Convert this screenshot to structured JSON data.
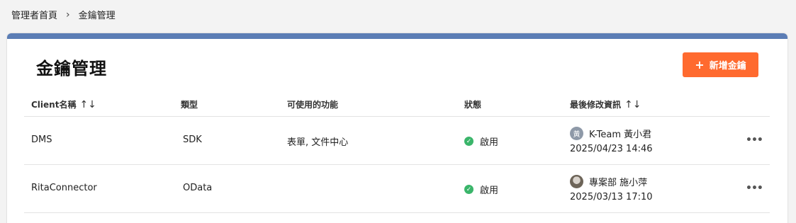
{
  "breadcrumb": {
    "home": "管理者首頁",
    "separator": "›",
    "current": "金鑰管理"
  },
  "page": {
    "title": "金鑰管理",
    "add_button_label": "新增金鑰",
    "add_button_icon": "plus-icon"
  },
  "colors": {
    "accent": "#ff6a2f",
    "topbar": "#5b7db5",
    "status_enabled": "#3ab56a"
  },
  "table": {
    "headers": {
      "client_name": "Client名稱",
      "type": "類型",
      "features": "可使用的功能",
      "status": "狀態",
      "last_modified": "最後修改資訊"
    },
    "rows": [
      {
        "client_name": "DMS",
        "type": "SDK",
        "features": "表單, 文件中心",
        "status": "啟用",
        "modifier": "K-Team 黃小君",
        "avatar_initial": "黃",
        "modified_at": "2025/04/23 14:46"
      },
      {
        "client_name": "RitaConnector",
        "type": "OData",
        "features": "",
        "status": "啟用",
        "modifier": "專案部 施小萍",
        "avatar_initial": "",
        "modified_at": "2025/03/13 17:10"
      }
    ]
  }
}
